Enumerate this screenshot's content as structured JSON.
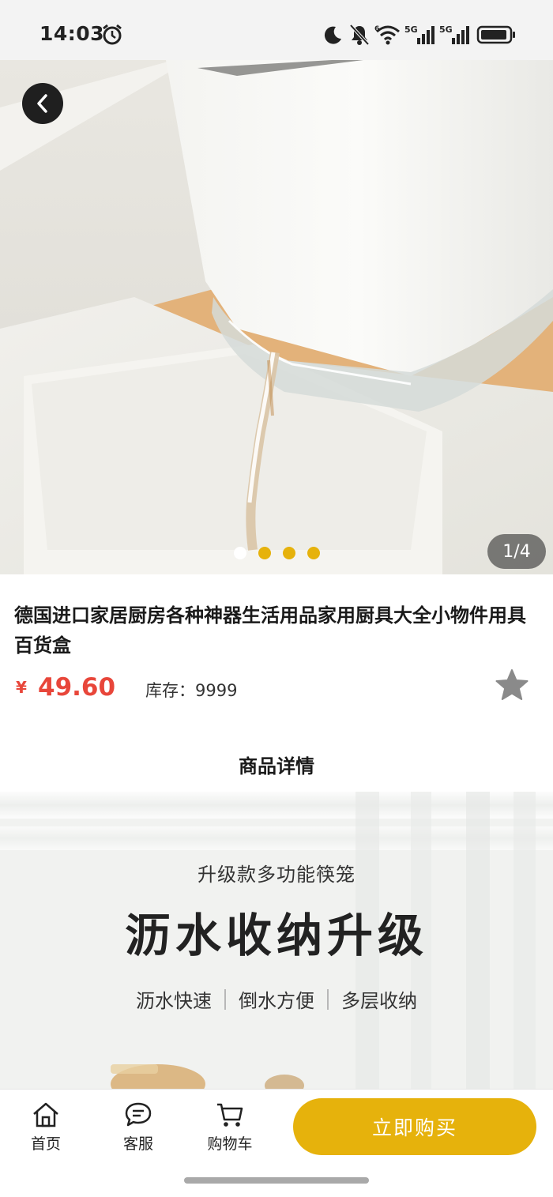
{
  "status_bar": {
    "time": "14:03",
    "icons": [
      "alarm-icon",
      "moon-icon",
      "bell-off-icon",
      "wifi-icon",
      "signal-5g-icon",
      "signal-5g-icon",
      "battery-icon"
    ],
    "network_label_1": "5G",
    "network_label_2": "5G",
    "wifi_label": "6"
  },
  "gallery": {
    "page_counter": "1/4",
    "current_index": 1,
    "total": 4,
    "back_icon": "chevron-left-icon"
  },
  "product": {
    "title": "德国进口家居厨房各种神器生活用品家用厨具大全小物件用具百货盒",
    "price_symbol": "¥",
    "price": "49.60",
    "stock_label": "库存：9999",
    "favorite_icon": "star-icon"
  },
  "details": {
    "section_title": "商品详情",
    "banner_subtitle": "升级款多功能筷笼",
    "banner_headline": "沥水收纳升级",
    "features": [
      "沥水快速",
      "倒水方便",
      "多层收纳"
    ]
  },
  "bottom_nav": {
    "items": [
      {
        "label": "首页",
        "icon": "home-icon"
      },
      {
        "label": "客服",
        "icon": "chat-icon"
      },
      {
        "label": "购物车",
        "icon": "cart-icon"
      }
    ],
    "buy_label": "立即购买"
  },
  "colors": {
    "accent": "#e6b20c",
    "price": "#e8463a"
  }
}
